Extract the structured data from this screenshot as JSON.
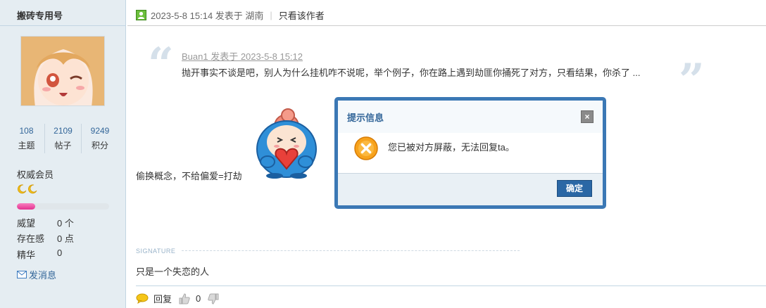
{
  "sidebar": {
    "username": "搬砖专用号",
    "stats": [
      {
        "num": "108",
        "label": "主题"
      },
      {
        "num": "2109",
        "label": "帖子"
      },
      {
        "num": "9249",
        "label": "积分"
      }
    ],
    "rank": "权威会员",
    "level_progress_percent": 20,
    "info": [
      {
        "key": "威望",
        "value": "0 个"
      },
      {
        "key": "存在感",
        "value": "0 点"
      },
      {
        "key": "精华",
        "value": "0"
      }
    ],
    "send_message": "发消息"
  },
  "post": {
    "date_line": "2023-5-8 15:14 发表于 湖南",
    "only_author": "只看该作者",
    "quote_author": "Buan1 发表于 2023-5-8 15:12",
    "quote_text": "抛开事实不谈是吧，别人为什么挂机咋不说呢，举个例子，你在路上遇到劫匪你捅死了对方，只看结果，你杀了 ...",
    "body_text": "偷换概念，不给偏爱=打劫",
    "signature_label": "SIGNATURE",
    "signature_text": "只是一个失恋的人"
  },
  "footer": {
    "reply": "回复",
    "like_count": "0"
  },
  "dialog": {
    "title": "提示信息",
    "close": "×",
    "message": "您已被对方屏蔽，无法回复ta。",
    "ok": "确定"
  },
  "colors": {
    "accent": "#336699",
    "dialog_border": "#3b78b5",
    "progress": "#e4318f"
  }
}
